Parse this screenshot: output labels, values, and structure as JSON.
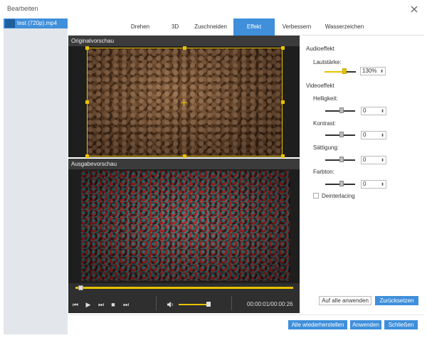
{
  "window": {
    "title": "Bearbeiten",
    "close_glyph": "✕"
  },
  "sidebar": {
    "file_name": "test (720p).mp4"
  },
  "tabs": [
    "Drehen",
    "3D",
    "Zuschneiden",
    "Effekt",
    "Verbessern",
    "Wasserzeichen"
  ],
  "active_tab": "Effekt",
  "preview": {
    "original_label": "Originalvorschau",
    "output_label": "Ausgabevorschau"
  },
  "player": {
    "timecode": "00:00:01/00:00:26",
    "progress": 0.02,
    "volume": 0.95,
    "icons": {
      "prev": "⏮",
      "play": "▶",
      "next": "⏭",
      "stop": "■",
      "end": "⏭",
      "volume": "🔈"
    }
  },
  "audio": {
    "section_label": "Audioeffekt",
    "volume_label": "Lautstärke:",
    "volume_value": "130%",
    "volume_level": 0.6
  },
  "video": {
    "section_label": "Videoeffekt",
    "brightness_label": "Helligkeit:",
    "brightness_value": "0",
    "contrast_label": "Kontrast:",
    "contrast_value": "0",
    "saturation_label": "Sättigung:",
    "saturation_value": "0",
    "hue_label": "Farbton:",
    "hue_value": "0",
    "deinterlacing_label": "Deinterlacing",
    "deinterlacing_checked": false
  },
  "buttons": {
    "apply_all": "Auf alle anwenden",
    "reset": "Zurücksetzen",
    "restore_all": "Alle wiederherstellen",
    "apply": "Anwenden",
    "close": "Schließen"
  },
  "colors": {
    "accent": "#3f8fdb",
    "highlight": "#e8c200"
  }
}
